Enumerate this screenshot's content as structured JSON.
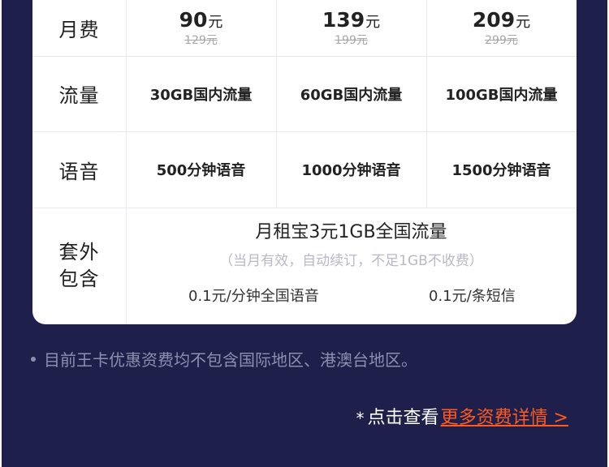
{
  "plans": {
    "monthly_fee_label": "月费",
    "data_label": "流量",
    "voice_label": "语音",
    "extras_label_line1": "套外",
    "extras_label_line2": "包含",
    "currency_unit": "元",
    "tiers": [
      {
        "price": "90",
        "original": "129元",
        "data": "30GB国内流量",
        "voice": "500分钟语音"
      },
      {
        "price": "139",
        "original": "199元",
        "data": "60GB国内流量",
        "voice": "1000分钟语音"
      },
      {
        "price": "209",
        "original": "299元",
        "data": "100GB国内流量",
        "voice": "1500分钟语音"
      }
    ],
    "extras": {
      "title": "月租宝3元1GB全国流量",
      "note": "（当月有效，自动续订，不足1GB不收费）",
      "voice_rate": "0.1元/分钟全国语音",
      "sms_rate": "0.1元/条短信"
    }
  },
  "footnote": "目前王卡优惠资费均不包含国际地区、港澳台地区。",
  "more_link": {
    "star": "*",
    "prefix": "点击查看",
    "link_text": "更多资费详情 >"
  },
  "colors": {
    "background": "#1e1f4a",
    "card": "#ffffff",
    "link": "#ff5a1f",
    "footnote": "#8d8fb0"
  }
}
